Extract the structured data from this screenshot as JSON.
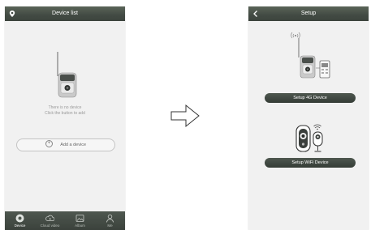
{
  "left": {
    "header": {
      "title": "Device list",
      "icon": "location-pin-icon"
    },
    "empty": {
      "line1": "There is no device",
      "line2": "Click the button to add"
    },
    "add_button": {
      "label": "Add a device",
      "icon": "plus-circle-icon"
    },
    "tabs": [
      {
        "label": "Device",
        "icon": "device-icon",
        "active": true
      },
      {
        "label": "Cloud video",
        "icon": "cloud-icon",
        "active": false
      },
      {
        "label": "Album",
        "icon": "album-icon",
        "active": false
      },
      {
        "label": "Me",
        "icon": "person-icon",
        "active": false
      }
    ]
  },
  "right": {
    "header": {
      "title": "Setup",
      "icon": "back-chevron-icon"
    },
    "setup_4g": {
      "label": "Setup 4G Device"
    },
    "setup_wifi": {
      "label": "Setup WiFi Device"
    }
  },
  "colors": {
    "header_bg": "#434b44",
    "screen_bg": "#f1f1f1",
    "pill_bg": "#3f4740"
  }
}
